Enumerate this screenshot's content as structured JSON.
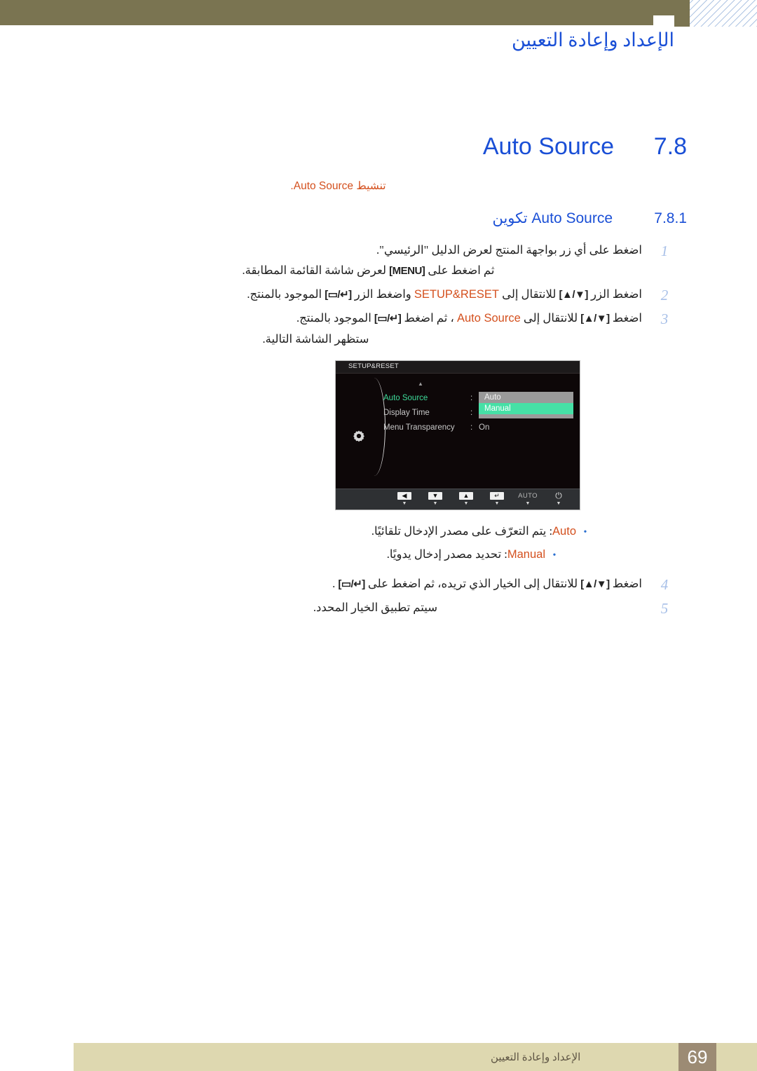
{
  "header": {
    "chapter_title": "الإعداد وإعادة التعيين",
    "band_color": "#7a7451",
    "title_color": "#1a4fd6"
  },
  "section": {
    "number": "7.8",
    "title": "Auto Source",
    "note": "تنشيط Auto Source.",
    "note_color": "#d4501e"
  },
  "subsection": {
    "number": "7.8.1",
    "title_ar": "تكوين",
    "title_en": "Auto Source"
  },
  "steps": [
    {
      "num": "1",
      "line1": "اضغط على أي زر بواجهة المنتج لعرض الدليل \"الرئيسي\".",
      "line2_a": "ثم اضغط على",
      "line2_key": "[MENU]",
      "line2_b": "لعرض شاشة القائمة المطابقة."
    },
    {
      "num": "2",
      "a": "اضغط الزر",
      "key1": "[▲/▼]",
      "b": "للانتقال إلى",
      "hl": "SETUP&RESET",
      "c": "واضغط الزر",
      "key2": "[▭/↵]",
      "d": "الموجود بالمنتج."
    },
    {
      "num": "3",
      "a": "اضغط",
      "key1": "[▲/▼]",
      "b": "للانتقال إلى",
      "hl": "Auto Source",
      "c": "، ثم اضغط",
      "key2": "[▭/↵]",
      "d": "الموجود بالمنتج.",
      "line2": "ستظهر الشاشة التالية."
    },
    {
      "num": "4",
      "a": "اضغط",
      "key1": "[▲/▼]",
      "b": "للانتقال إلى الخيار الذي تريده، ثم اضغط على",
      "key2": "[▭/↵]",
      "d": "."
    },
    {
      "num": "5",
      "line1": "سيتم تطبيق الخيار المحدد."
    }
  ],
  "osd": {
    "title": "SETUP&RESET",
    "up_arrow": "▲",
    "rows": [
      {
        "label": "Auto Source",
        "colon": ":",
        "value": "",
        "active": true
      },
      {
        "label": "Display Time",
        "colon": ":",
        "value": "",
        "active": false
      },
      {
        "label": "Menu Transparency",
        "colon": ":",
        "value": "On",
        "active": false
      }
    ],
    "options": [
      {
        "label": "Auto",
        "selected": false
      },
      {
        "label": "Manual",
        "selected": true
      }
    ],
    "buttons": [
      {
        "glyph": "◀",
        "kind": "box",
        "name": "left"
      },
      {
        "glyph": "▼",
        "kind": "box",
        "name": "down"
      },
      {
        "glyph": "▲",
        "kind": "box",
        "name": "up"
      },
      {
        "glyph": "↵",
        "kind": "box",
        "name": "enter"
      },
      {
        "glyph": "AUTO",
        "kind": "text",
        "name": "auto"
      },
      {
        "glyph": "⏻",
        "kind": "power",
        "name": "power"
      }
    ],
    "tick": "▼",
    "selected_color": "#46e0a6",
    "active_label_color": "#3ddc9a"
  },
  "bullets": [
    {
      "term": "Auto",
      "text": ": يتم التعرّف على مصدر الإدخال تلقائيًا.",
      "indent": false
    },
    {
      "term": "Manual",
      "text": ": تحديد مصدر إدخال يدويًا.",
      "indent": true
    }
  ],
  "footer": {
    "page_number": "69",
    "text": "الإعداد وإعادة التعيين",
    "bar_color": "#ded8b0",
    "page_box_color": "#9c8b74"
  }
}
